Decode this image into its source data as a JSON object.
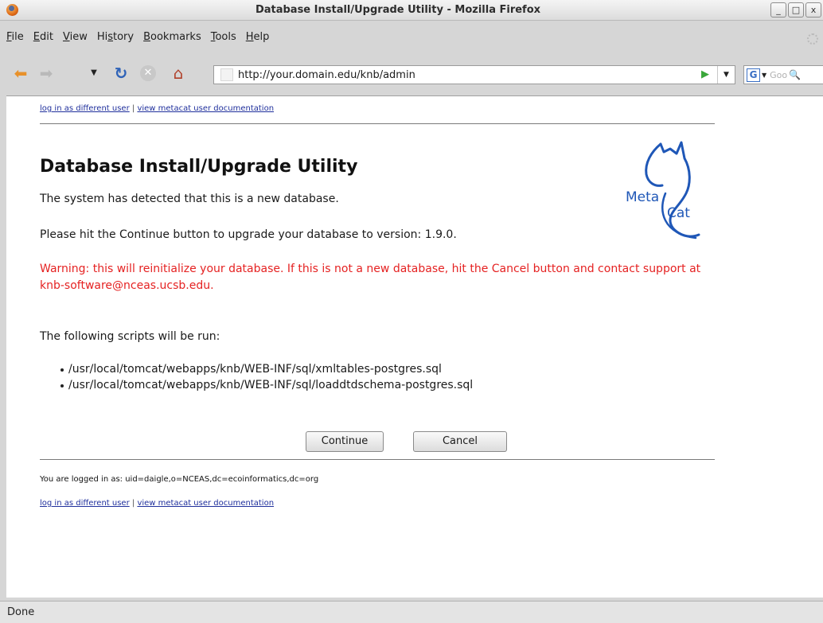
{
  "window": {
    "title": "Database Install/Upgrade Utility - Mozilla Firefox",
    "minimize": "_",
    "maximize": "□",
    "close": "x"
  },
  "menu": [
    {
      "ul": "F",
      "rest": "ile"
    },
    {
      "ul": "E",
      "rest": "dit"
    },
    {
      "ul": "V",
      "rest": "iew"
    },
    {
      "pre": "Hi",
      "ul": "s",
      "rest": "tory"
    },
    {
      "ul": "B",
      "rest": "ookmarks"
    },
    {
      "ul": "T",
      "rest": "ools"
    },
    {
      "ul": "H",
      "rest": "elp"
    }
  ],
  "toolbar": {
    "url": "http://your.domain.edu/knb/admin",
    "search_engine": "G",
    "search_placeholder": "Goo"
  },
  "page": {
    "links": {
      "login": "log in as different user",
      "separator": " | ",
      "docs": "view metacat user documentation"
    },
    "heading": "Database Install/Upgrade Utility",
    "detected": "The system has detected that this is a new database.",
    "instruction": "Please hit the Continue button to upgrade your database to version: 1.9.0.",
    "warning": "Warning: this will reinitialize your database. If this is not a new database, hit the Cancel button and contact support at knb-software@nceas.ucsb.edu.",
    "scripts_intro": "The following scripts will be run:",
    "scripts": [
      "/usr/local/tomcat/webapps/knb/WEB-INF/sql/xmltables-postgres.sql",
      "/usr/local/tomcat/webapps/knb/WEB-INF/sql/loaddtdschema-postgres.sql"
    ],
    "continue_label": "Continue",
    "cancel_label": "Cancel",
    "logged_in": "You are logged in as: uid=daigle,o=NCEAS,dc=ecoinformatics,dc=org",
    "logo": {
      "line1": "Meta",
      "line2": "Cat"
    }
  },
  "status": "Done",
  "colors": {
    "warning": "#e52222",
    "link": "#1f2f9c",
    "logo": "#1f57b7"
  }
}
